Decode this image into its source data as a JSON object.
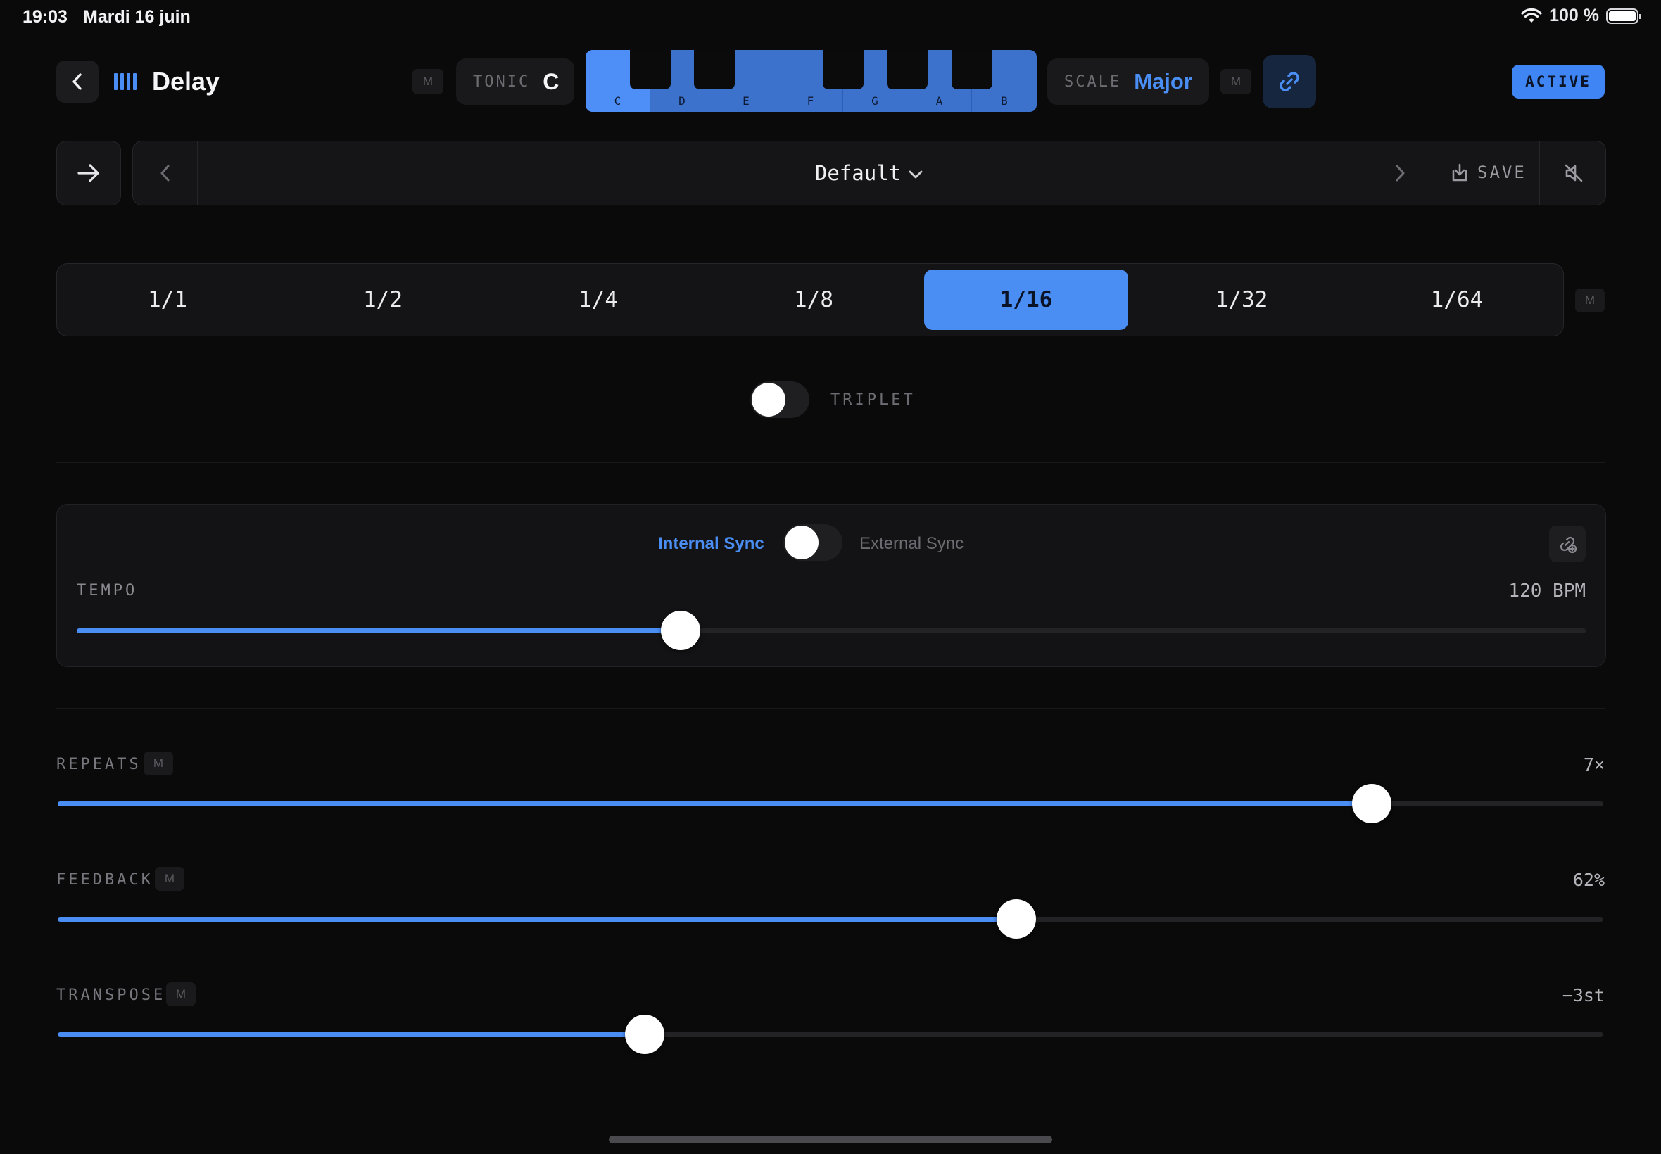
{
  "status_bar": {
    "time": "19:03",
    "date": "Mardi 16 juin",
    "battery": "100 %"
  },
  "header": {
    "title": "Delay",
    "m_label": "M",
    "tonic_label": "TONIC",
    "tonic_value": "C",
    "keys": [
      "C",
      "D",
      "E",
      "F",
      "G",
      "A",
      "B"
    ],
    "scale_label": "SCALE",
    "scale_value": "Major",
    "active_label": "ACTIVE"
  },
  "preset": {
    "name": "Default",
    "save_label": "SAVE"
  },
  "divisions": {
    "options": [
      "1/1",
      "1/2",
      "1/4",
      "1/8",
      "1/16",
      "1/32",
      "1/64"
    ],
    "selected": "1/16",
    "m_label": "M"
  },
  "triplet": {
    "label": "TRIPLET",
    "on": false
  },
  "sync": {
    "internal_label": "Internal Sync",
    "external_label": "External Sync",
    "mode": "internal",
    "tempo_label": "TEMPO",
    "tempo_value": "120 BPM",
    "tempo_level": 0.4
  },
  "params": [
    {
      "label": "REPEATS",
      "m_label": "M",
      "value": "7×",
      "level": 0.85
    },
    {
      "label": "FEEDBACK",
      "m_label": "M",
      "value": "62%",
      "level": 0.62
    },
    {
      "label": "TRANSPOSE",
      "m_label": "M",
      "value": "−3st",
      "level": 0.38
    }
  ],
  "colors": {
    "accent": "#4a8df3",
    "background": "#0a0a0b",
    "panel": "#141416"
  }
}
